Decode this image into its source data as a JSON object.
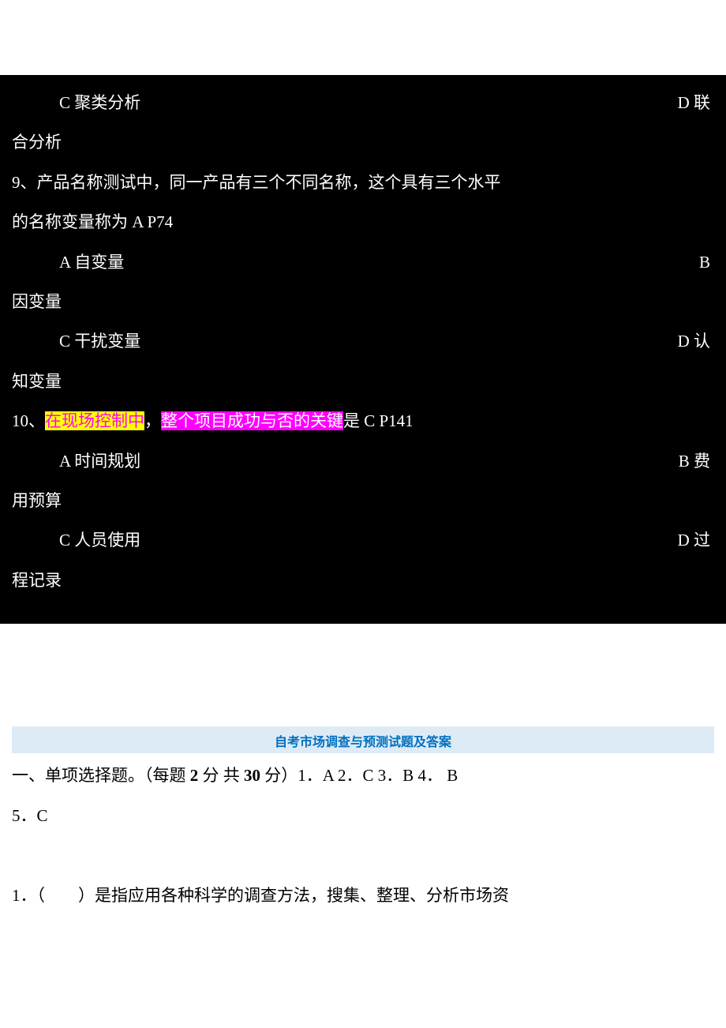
{
  "blackSection": {
    "q8": {
      "optC": "C 聚类分析",
      "optD": "D 联",
      "optD_cont": "合分析"
    },
    "q9": {
      "stem1": "9、产品名称测试中，同一产品有三个不同名称，这个具有三个水平",
      "stem2": "的名称变量称为 A P74",
      "optA": "A 自变量",
      "optB": "B",
      "optB_cont": "因变量",
      "optC": "C 干扰变量",
      "optD": "D 认",
      "optD_cont": "知变量"
    },
    "q10": {
      "prefix": "10、",
      "hl1": "在现场控制中",
      "mid": "，",
      "hl2": "整个项目成功与否的关键",
      "suffix": "是 C P141",
      "optA": "A 时间规划",
      "optB": "B 费",
      "optB_cont": "用预算",
      "optC": "C 人员使用",
      "optD": "D 过",
      "optD_cont": "程记录"
    }
  },
  "lowerSection": {
    "title": "自考市场调查与预测试题及答案",
    "heading": {
      "p1": "一、单项选择题。（每题 ",
      "b1": "2",
      "p2": " 分  共 ",
      "b2": "30",
      "p3": " 分）1．A 2．C 3．B 4．  B",
      "line2": "5．C"
    },
    "q1": "1．（　　）是指应用各种科学的调查方法，搜集、整理、分析市场资"
  }
}
